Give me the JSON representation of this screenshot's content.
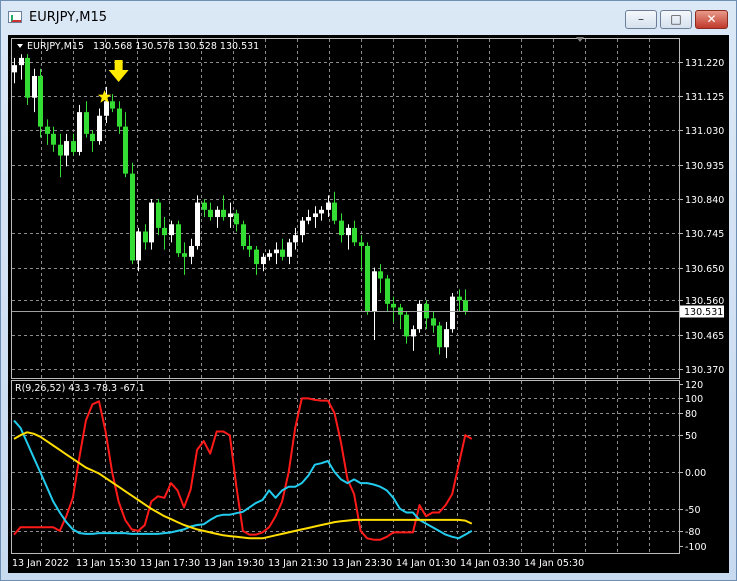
{
  "window": {
    "title": "EURJPY,M15",
    "minimize_glyph": "–",
    "maximize_glyph": "□",
    "close_glyph": "✕"
  },
  "chart_data": [
    {
      "type": "candlestick",
      "symbol_label": "EURJPY,M15",
      "ohlc_label": "130.568 130.578 130.528 130.531",
      "current_price_label": "130.531",
      "current_price": 130.531,
      "y_ticks": [
        "131.220",
        "131.125",
        "131.030",
        "130.935",
        "130.840",
        "130.745",
        "130.650",
        "130.560",
        "130.465",
        "130.370"
      ],
      "ylim": [
        130.345,
        131.285
      ],
      "colors": {
        "bull": "#ffffff",
        "bear": "#33dd33",
        "grid": "#8c8c8c",
        "background": "#000000",
        "annotation": "#ffea00"
      },
      "annotations": [
        "arrow-down",
        "star"
      ],
      "candles": [
        [
          131.19,
          131.23,
          131.16,
          131.21
        ],
        [
          131.21,
          131.24,
          131.17,
          131.23
        ],
        [
          131.23,
          131.24,
          131.1,
          131.12
        ],
        [
          131.12,
          131.2,
          131.08,
          131.18
        ],
        [
          131.18,
          131.2,
          131.01,
          131.04
        ],
        [
          131.04,
          131.06,
          130.99,
          131.02
        ],
        [
          131.02,
          131.04,
          130.97,
          130.99
        ],
        [
          130.99,
          131.02,
          130.9,
          130.96
        ],
        [
          130.96,
          131.02,
          130.93,
          131.0
        ],
        [
          131.0,
          131.02,
          130.96,
          130.97
        ],
        [
          130.97,
          131.1,
          130.96,
          131.08
        ],
        [
          131.08,
          131.11,
          131.01,
          131.02
        ],
        [
          131.02,
          131.03,
          130.97,
          131.0
        ],
        [
          131.0,
          131.09,
          130.99,
          131.07
        ],
        [
          131.07,
          131.15,
          131.05,
          131.11
        ],
        [
          131.11,
          131.13,
          131.08,
          131.09
        ],
        [
          131.09,
          131.11,
          131.02,
          131.04
        ],
        [
          131.04,
          131.08,
          130.9,
          130.91
        ],
        [
          130.91,
          130.94,
          130.66,
          130.67
        ],
        [
          130.67,
          130.76,
          130.64,
          130.75
        ],
        [
          130.75,
          130.77,
          130.7,
          130.72
        ],
        [
          130.72,
          130.84,
          130.7,
          130.83
        ],
        [
          130.83,
          130.84,
          130.74,
          130.76
        ],
        [
          130.76,
          130.79,
          130.7,
          130.74
        ],
        [
          130.74,
          130.78,
          130.72,
          130.77
        ],
        [
          130.77,
          130.78,
          130.68,
          130.69
        ],
        [
          130.69,
          130.72,
          130.63,
          130.68
        ],
        [
          130.68,
          130.73,
          130.66,
          130.71
        ],
        [
          130.71,
          130.85,
          130.7,
          130.83
        ],
        [
          130.83,
          130.84,
          130.79,
          130.81
        ],
        [
          130.81,
          130.83,
          130.78,
          130.79
        ],
        [
          130.79,
          130.82,
          130.76,
          130.81
        ],
        [
          130.81,
          130.85,
          130.78,
          130.79
        ],
        [
          130.79,
          130.83,
          130.76,
          130.8
        ],
        [
          130.8,
          130.81,
          130.75,
          130.77
        ],
        [
          130.77,
          130.78,
          130.7,
          130.71
        ],
        [
          130.71,
          130.74,
          130.68,
          130.7
        ],
        [
          130.7,
          130.71,
          130.63,
          130.66
        ],
        [
          130.66,
          130.69,
          130.64,
          130.68
        ],
        [
          130.68,
          130.7,
          130.67,
          130.69
        ],
        [
          130.69,
          130.72,
          130.66,
          130.7
        ],
        [
          130.7,
          130.73,
          130.67,
          130.68
        ],
        [
          130.68,
          130.73,
          130.66,
          130.72
        ],
        [
          130.72,
          130.76,
          130.7,
          130.74
        ],
        [
          130.74,
          130.79,
          130.72,
          130.78
        ],
        [
          130.78,
          130.81,
          130.77,
          130.79
        ],
        [
          130.79,
          130.82,
          130.76,
          130.8
        ],
        [
          130.8,
          130.82,
          130.78,
          130.81
        ],
        [
          130.81,
          130.85,
          130.79,
          130.83
        ],
        [
          130.83,
          130.86,
          130.77,
          130.78
        ],
        [
          130.78,
          130.8,
          130.72,
          130.74
        ],
        [
          130.74,
          130.77,
          130.7,
          130.76
        ],
        [
          130.76,
          130.78,
          130.71,
          130.72
        ],
        [
          130.72,
          130.74,
          130.64,
          130.71
        ],
        [
          130.71,
          130.72,
          130.52,
          130.53
        ],
        [
          130.53,
          130.65,
          130.45,
          130.64
        ],
        [
          130.64,
          130.66,
          130.58,
          130.62
        ],
        [
          130.62,
          130.63,
          130.53,
          130.55
        ],
        [
          130.55,
          130.57,
          130.5,
          130.54
        ],
        [
          130.54,
          130.55,
          130.48,
          130.52
        ],
        [
          130.52,
          130.53,
          130.44,
          130.46
        ],
        [
          130.46,
          130.49,
          130.42,
          130.48
        ],
        [
          130.48,
          130.56,
          130.47,
          130.55
        ],
        [
          130.55,
          130.56,
          130.48,
          130.51
        ],
        [
          130.51,
          130.53,
          130.47,
          130.49
        ],
        [
          130.49,
          130.5,
          130.41,
          130.43
        ],
        [
          130.43,
          130.5,
          130.4,
          130.48
        ],
        [
          130.48,
          130.58,
          130.47,
          130.57
        ],
        [
          130.57,
          130.59,
          130.53,
          130.56
        ],
        [
          130.56,
          130.59,
          130.52,
          130.53
        ]
      ]
    },
    {
      "type": "line",
      "label": "R(9,26,52) 43.3 -78.3 -67.1",
      "y_ticks": [
        "120",
        "100",
        "80",
        "50",
        "0.00",
        "-50",
        "-80",
        "-100"
      ],
      "ylim": [
        -110,
        125
      ],
      "x_tick_labels": [
        "13 Jan 2022",
        "13 Jan 15:30",
        "13 Jan 17:30",
        "13 Jan 19:30",
        "13 Jan 21:30",
        "13 Jan 23:30",
        "14 Jan 01:30",
        "14 Jan 03:30",
        "14 Jan 05:30"
      ],
      "series": [
        {
          "color": "#ff1a1a",
          "values": [
            -85,
            -75,
            -75,
            -75,
            -75,
            -75,
            -75,
            -80,
            -60,
            -35,
            20,
            70,
            92,
            96,
            55,
            0,
            -40,
            -65,
            -78,
            -80,
            -72,
            -40,
            -33,
            -35,
            -15,
            -25,
            -48,
            -24,
            30,
            42,
            25,
            55,
            55,
            50,
            -20,
            -80,
            -85,
            -85,
            -82,
            -75,
            -60,
            -40,
            0,
            60,
            100,
            100,
            98,
            97,
            97,
            80,
            40,
            -10,
            -30,
            -80,
            -90,
            -92,
            -92,
            -88,
            -82,
            -82,
            -82,
            -82,
            -45,
            -60,
            -55,
            -55,
            -45,
            -30,
            10,
            50,
            45
          ]
        },
        {
          "color": "#22ccee",
          "values": [
            70,
            60,
            40,
            20,
            0,
            -20,
            -40,
            -55,
            -68,
            -78,
            -83,
            -84,
            -84,
            -83,
            -83,
            -83,
            -83,
            -83,
            -84,
            -84,
            -84,
            -84,
            -84,
            -83,
            -82,
            -80,
            -78,
            -74,
            -72,
            -71,
            -65,
            -60,
            -58,
            -58,
            -56,
            -54,
            -48,
            -42,
            -38,
            -25,
            -35,
            -25,
            -20,
            -20,
            -15,
            -5,
            10,
            12,
            15,
            0,
            -10,
            -15,
            -10,
            -15,
            -15,
            -17,
            -20,
            -25,
            -35,
            -50,
            -55,
            -55,
            -65,
            -70,
            -75,
            -80,
            -85,
            -88,
            -90,
            -85,
            -80
          ]
        },
        {
          "color": "#ffdd00",
          "values": [
            45,
            50,
            54,
            52,
            48,
            42,
            36,
            30,
            24,
            18,
            12,
            6,
            2,
            -2,
            -8,
            -14,
            -20,
            -26,
            -32,
            -38,
            -44,
            -50,
            -55,
            -60,
            -64,
            -68,
            -72,
            -75,
            -78,
            -80,
            -82,
            -84,
            -86,
            -87,
            -88,
            -89,
            -90,
            -90,
            -90,
            -88,
            -86,
            -84,
            -82,
            -80,
            -78,
            -76,
            -74,
            -72,
            -70,
            -68,
            -67,
            -66,
            -65,
            -65,
            -65,
            -65,
            -65,
            -65,
            -65,
            -65,
            -65,
            -65,
            -65,
            -65,
            -65,
            -65,
            -65,
            -65,
            -65,
            -66,
            -70
          ]
        }
      ]
    }
  ]
}
